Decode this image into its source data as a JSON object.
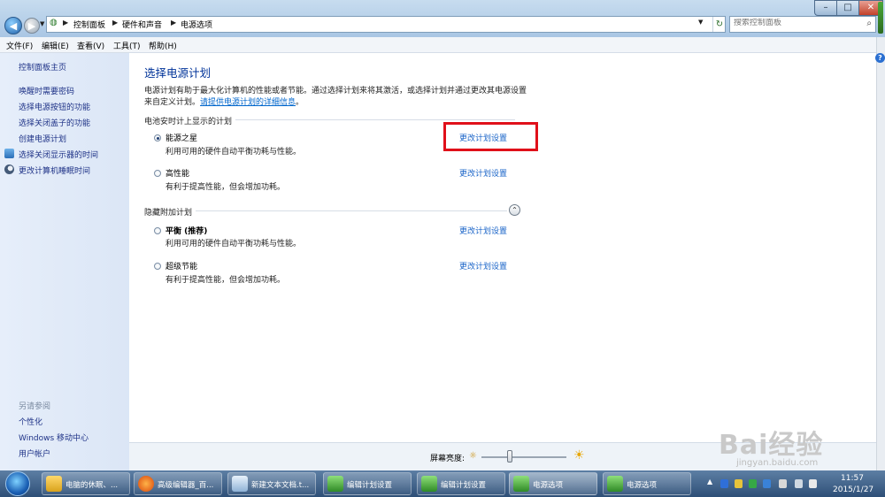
{
  "address_bar": {
    "crumbs": [
      "控制面板",
      "硬件和声音",
      "电源选项"
    ]
  },
  "search": {
    "placeholder": "搜索控制面板"
  },
  "menu": [
    "文件(F)",
    "编辑(E)",
    "查看(V)",
    "工具(T)",
    "帮助(H)"
  ],
  "sidebar": {
    "home": "控制面板主页",
    "links": [
      "唤醒时需要密码",
      "选择电源按钮的功能",
      "选择关闭盖子的功能",
      "创建电源计划",
      "选择关闭显示器的时间",
      "更改计算机睡眠时间"
    ],
    "see_also": "另请参阅",
    "see_also_links": [
      "个性化",
      "Windows 移动中心",
      "用户帐户"
    ]
  },
  "main": {
    "title": "选择电源计划",
    "desc_line1": "电源计划有助于最大化计算机的性能或者节能。通过选择计划来将其激活，或选择计划并通过更改其电源设置",
    "desc_line2_prefix": "来自定义计划。",
    "desc_link": "请提供电源计划的详细信息",
    "desc_line2_suffix": "。",
    "section_battery": "电池安时计上显示的计划",
    "section_hidden": "隐藏附加计划",
    "change_label": "更改计划设置",
    "plans": [
      {
        "name": "能源之星",
        "desc": "利用可用的硬件自动平衡功耗与性能。",
        "selected": true
      },
      {
        "name": "高性能",
        "desc": "有利于提高性能，但会增加功耗。",
        "selected": false
      },
      {
        "name": "平衡 (推荐)",
        "desc": "利用可用的硬件自动平衡功耗与性能。",
        "selected": false
      },
      {
        "name": "超级节能",
        "desc": "有利于提高性能，但会增加功耗。",
        "selected": false
      }
    ]
  },
  "brightness": {
    "label": "屏幕亮度:",
    "level": 0.33
  },
  "taskbar": {
    "tasks": [
      "电脑的休眠、...",
      "高级编辑器_百...",
      "新建文本文档.t...",
      "编辑计划设置",
      "编辑计划设置",
      "电源选项",
      "电源选项"
    ],
    "time": "11:57",
    "date": "2015/1/27"
  },
  "watermark": {
    "text": "Bai经验",
    "url": "jingyan.baidu.com"
  },
  "colors": {
    "accent": "#003399",
    "link": "#1a64c8",
    "highlight": "#e0101a"
  }
}
